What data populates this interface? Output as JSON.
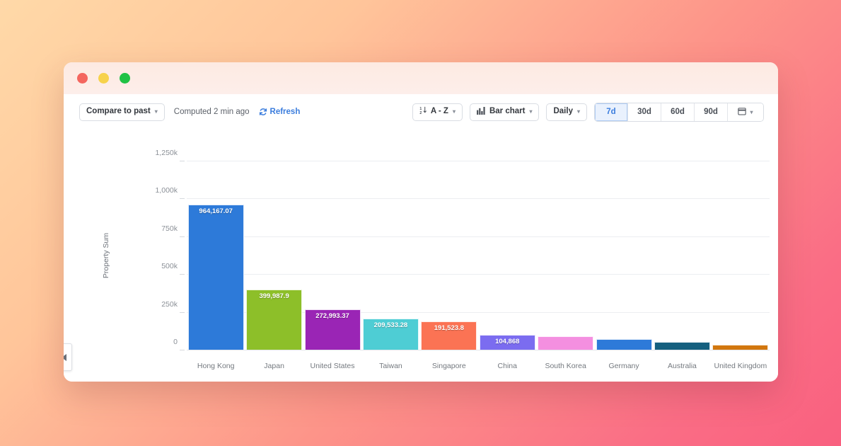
{
  "window": {
    "traffic_lights": [
      {
        "name": "close",
        "color": "#f4665f"
      },
      {
        "name": "minimize",
        "color": "#f7d24b"
      },
      {
        "name": "zoom",
        "color": "#20c245"
      }
    ]
  },
  "toolbar": {
    "compare_label": "Compare to past",
    "computed_text": "Computed 2 min ago",
    "refresh_label": "Refresh",
    "sort_label": "A - Z",
    "chart_type_label": "Bar chart",
    "granularity_label": "Daily",
    "ranges": [
      {
        "label": "7d",
        "active": true
      },
      {
        "label": "30d",
        "active": false
      },
      {
        "label": "60d",
        "active": false
      },
      {
        "label": "90d",
        "active": false
      }
    ],
    "calendar_icon": "calendar-icon",
    "accent_color": "#3b7ddd",
    "active_range_bg": "#e9f1fd"
  },
  "collapse_handle": {
    "icon": "chevron-left-icon"
  },
  "chart_data": {
    "type": "bar",
    "title": "",
    "xlabel": "",
    "ylabel": "Property Sum",
    "ylim": [
      0,
      1375000
    ],
    "yticks": [
      0,
      250000,
      500000,
      750000,
      1000000,
      1250000
    ],
    "ytick_labels": [
      "0",
      "250k",
      "500k",
      "750k",
      "1,000k",
      "1,250k"
    ],
    "grid": true,
    "legend": "none",
    "categories": [
      "Hong Kong",
      "Japan",
      "United States",
      "Taiwan",
      "Singapore",
      "China",
      "South Korea",
      "Germany",
      "Australia",
      "United Kingdom"
    ],
    "values": [
      964167.07,
      399987.9,
      272993.37,
      209533.28,
      191523.8,
      104868,
      95000,
      77000,
      55000,
      36000
    ],
    "value_labels": [
      "964,167.07",
      "399,987.9",
      "272,993.37",
      "209,533.28",
      "191,523.8",
      "104,868",
      "",
      "",
      "",
      ""
    ],
    "colors": [
      "#2d7ad9",
      "#8dbf29",
      "#9a25b5",
      "#4ecdd4",
      "#fb7354",
      "#7b6cf0",
      "#f48fe0",
      "#2d7ad9",
      "#15607f",
      "#d2770f"
    ]
  }
}
